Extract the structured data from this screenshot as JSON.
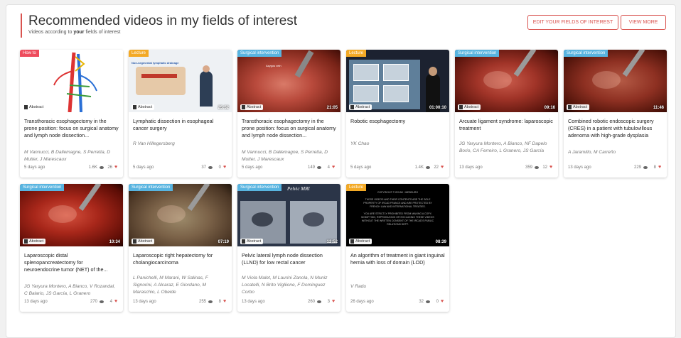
{
  "section": {
    "title": "Recommended videos in my fields of interest",
    "subtitle_pre": "Videos according to ",
    "subtitle_bold": "your",
    "subtitle_post": " fields of interest",
    "edit_button": "EDIT YOUR FIELDS OF INTEREST",
    "more_button": "VIEW MORE"
  },
  "abstract_label": "Abstract",
  "cards": [
    {
      "tag": "How to",
      "tag_type": "howto",
      "duration": "",
      "title": "Transthoracic esophagectomy in the prone position: focus on surgical anatomy and lymph node dissection...",
      "authors": "M Vannucci, B Dallemagne, S Perretta, D Mutter, J Marescaux",
      "date": "5 days ago",
      "views": "1.6K",
      "likes": "26"
    },
    {
      "tag": "Lecture",
      "tag_type": "lecture",
      "duration": "25:52",
      "title": "Lymphatic dissection in esophageal cancer surgery",
      "authors": "R Van Hillegersberg",
      "date": "5 days ago",
      "views": "37",
      "likes": "0"
    },
    {
      "tag": "Surgical intervention",
      "tag_type": "surgical",
      "duration": "21:05",
      "title": "Transthoracic esophagectomy in the prone position: focus on surgical anatomy and lymph node dissection...",
      "authors": "M Vannucci, B Dallemagne, S Perretta, D Mutter, J Marescaux",
      "date": "5 days ago",
      "views": "149",
      "likes": "4"
    },
    {
      "tag": "Lecture",
      "tag_type": "lecture",
      "duration": "01:00:10",
      "title": "Robotic esophagectomy",
      "authors": "YK Chao",
      "date": "5 days ago",
      "views": "1.4K",
      "likes": "22"
    },
    {
      "tag": "Surgical intervention",
      "tag_type": "surgical",
      "duration": "09:16",
      "title": "Arcuate ligament syndrome: laparoscopic treatment",
      "authors": "JG Yaryura Montero, A Bianco, NF Dapelo Borio, CA Ferreiro, L Granero, JS García",
      "date": "13 days ago",
      "views": "359",
      "likes": "12"
    },
    {
      "tag": "Surgical intervention",
      "tag_type": "surgical",
      "duration": "11:46",
      "title": "Combined robotic endoscopic surgery (CRES) in a patient with tubulovillous adenoma with high-grade dysplasia",
      "authors": "A Jaramillo, M Carreño",
      "date": "13 days ago",
      "views": "229",
      "likes": "8"
    },
    {
      "tag": "Surgical intervention",
      "tag_type": "surgical",
      "duration": "10:34",
      "title": "Laparoscopic distal splenopancreatectomy for neuroendocrine tumor (NET) of the...",
      "authors": "JG Yaryura Montero, A Bianco, V Rozandal, C Balario, JS García, L Granero",
      "date": "13 days ago",
      "views": "270",
      "likes": "4"
    },
    {
      "tag": "Surgical intervention",
      "tag_type": "surgical",
      "duration": "07:19",
      "title": "Laparoscopic right hepatectomy for cholangiocarcinoma",
      "authors": "L Panichelli, M Marani, W Salinas, F Signorini, A Alcaraz, E Giordano, M Maraschio, L Obeide",
      "date": "13 days ago",
      "views": "255",
      "likes": "8"
    },
    {
      "tag": "Surgical intervention",
      "tag_type": "surgical",
      "duration": "12:52",
      "title": "Pelvic lateral lymph node dissection (LLND) for low rectal cancer",
      "authors": "M Viola Malet, M Laurini Zanola, N Muniz Locatelli, N Brito Vigliione, F Dominguez Corbo",
      "date": "13 days ago",
      "views": "260",
      "likes": "3"
    },
    {
      "tag": "Lecture",
      "tag_type": "lecture",
      "duration": "08:39",
      "title": "An algorithm of treatment in giant inguinal hernia with loss of domain (LOD)",
      "authors": "V Radu",
      "date": "26 days ago",
      "views": "32",
      "likes": "0"
    }
  ],
  "thumbs": {
    "slide_title": "Non-segmental lymphatic drainage",
    "mri_title": "Pelvic MRI",
    "surg_label_top": "Azygos vein",
    "copyright_text": "COPYRIGHT © IRCAD / WEBSURG"
  },
  "colors": {
    "accent": "#d9534f",
    "howto": "#ee4c5d",
    "lecture": "#f3a925",
    "surgical": "#58b4e0"
  }
}
